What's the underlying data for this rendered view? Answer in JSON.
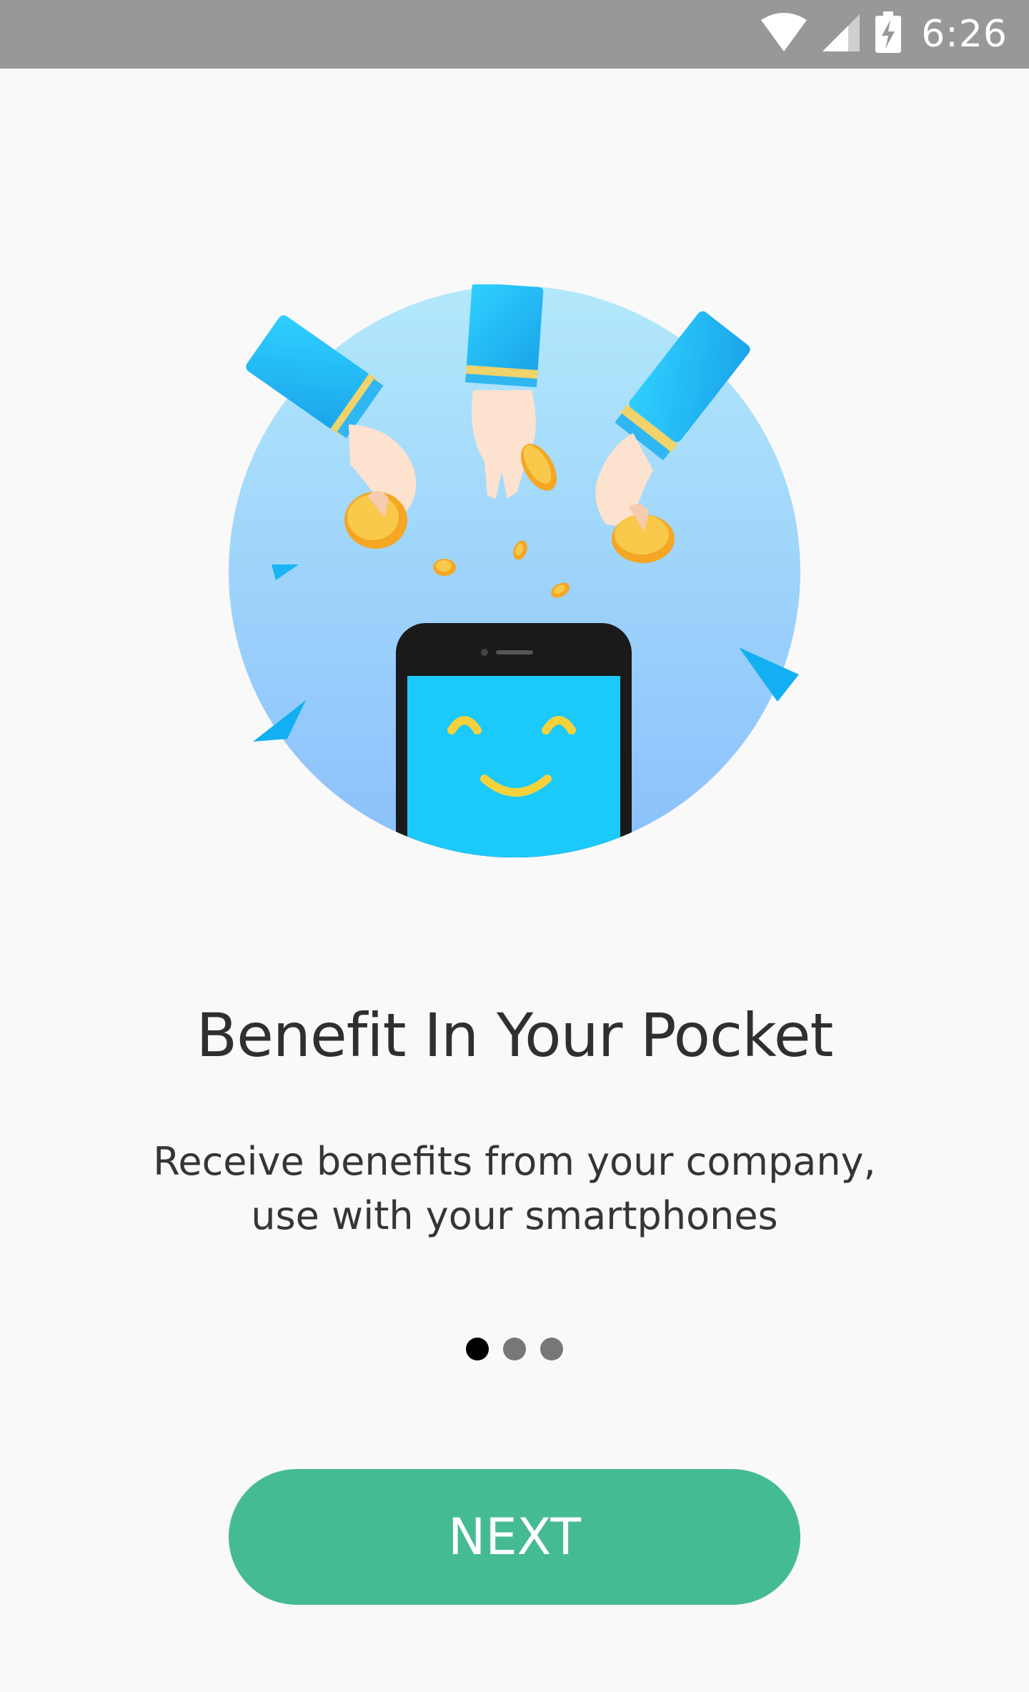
{
  "status_bar": {
    "time": "6:26",
    "icons": [
      "wifi-icon",
      "cellular-signal-icon",
      "battery-charging-icon"
    ]
  },
  "onboarding": {
    "illustration": "hands-dropping-coins-into-smiling-phone",
    "title": "Benefit In Your Pocket",
    "subtitle": "Receive benefits from your company, use with your smartphones",
    "page_indicator": {
      "current": 1,
      "total": 3
    },
    "next_label": "NEXT"
  },
  "colors": {
    "status_bar": "#989898",
    "background": "#f9f9f9",
    "accent": "#45bb93",
    "dot_active": "#000000",
    "dot_inactive": "#777777"
  }
}
